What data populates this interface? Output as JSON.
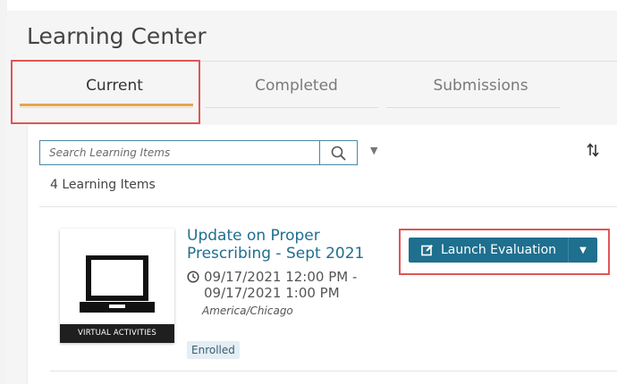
{
  "page": {
    "title": "Learning Center"
  },
  "tabs": [
    {
      "label": "Current",
      "active": true
    },
    {
      "label": "Completed",
      "active": false
    },
    {
      "label": "Submissions",
      "active": false
    }
  ],
  "search": {
    "placeholder": "Search Learning Items",
    "value": ""
  },
  "list": {
    "count_label": "4 Learning Items"
  },
  "item": {
    "thumbnail_label": "VIRTUAL ACTIVITIES",
    "title": "Update on Proper Prescribing - Sept 2021",
    "time_start": "09/17/2021 12:00 PM -",
    "time_end": "09/17/2021 1:00 PM",
    "timezone": "America/Chicago",
    "status_badge": "Enrolled",
    "action_label": "Launch Evaluation"
  },
  "colors": {
    "accent": "#1f6f8e",
    "tab_underline": "#e8a44a",
    "highlight": "#e05555",
    "title_link": "#1f6e8e"
  },
  "icons": [
    "search-icon",
    "chevron-down-icon",
    "sort-icon",
    "laptop-icon",
    "clock-icon",
    "edit-icon"
  ]
}
